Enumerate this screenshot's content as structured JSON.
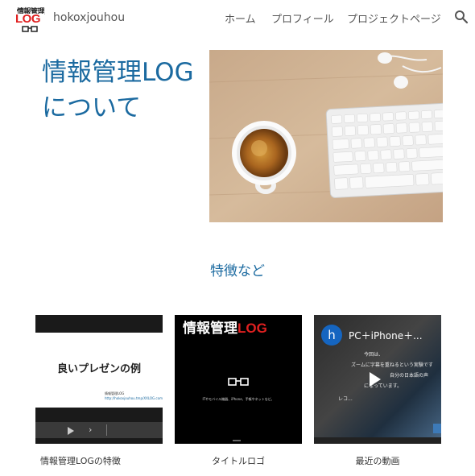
{
  "header": {
    "logo": {
      "line1": "情報管理",
      "line2": "LOG"
    },
    "site_title": "hokoxjouhou",
    "nav": {
      "home": "ホーム",
      "profile": "プロフィール",
      "project": "プロジェクトページ"
    }
  },
  "hero": {
    "title": "情報管理LOGについて"
  },
  "features": {
    "heading": "特徴など",
    "cards": [
      {
        "caption": "情報管理LOGの特徴",
        "slide_text": "良いプレゼンの例",
        "slide_footer_1": "情報管理LOG",
        "slide_footer_2": "http://hokoxjouhou.tmp/XXLOG.com"
      },
      {
        "caption": "タイトルロゴ",
        "title_black": "情報管理",
        "title_red": "LOG",
        "subtitle": "ITやモバイル機器、iPhone、手帳やネットなど。"
      },
      {
        "caption": "最近の動画",
        "avatar": "h",
        "video_title": "PC＋iPhone＋...",
        "lines": [
          "今回は、",
          "ズームに字幕を重ねるという実験です",
          "自分の日本語の声",
          "になっています。",
          "レコ..."
        ]
      }
    ]
  },
  "colors": {
    "accent": "#1b6aa0",
    "logo_red": "#e02020"
  },
  "icons": {
    "search": "search-icon",
    "play": "play-icon",
    "next": "chevron-right-icon",
    "glasses": "glasses-icon"
  }
}
